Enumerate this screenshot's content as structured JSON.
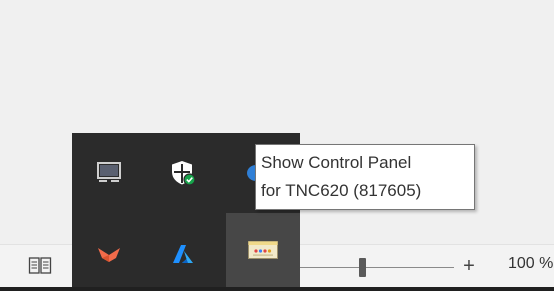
{
  "tooltip": {
    "line1": "Show Control Panel",
    "line2": "for TNC620 (817605)"
  },
  "status_bar": {
    "zoom_plus": "+",
    "zoom_level": "100 %"
  },
  "tray_icons": [
    {
      "name": "monitor-icon"
    },
    {
      "name": "windows-security-shield-icon"
    },
    {
      "name": "cloud-app-icon"
    },
    {
      "name": "orange-bird-app-icon"
    },
    {
      "name": "azure-a-icon"
    },
    {
      "name": "control-panel-icon"
    }
  ],
  "colors": {
    "flyout_bg": "#2b2b2b",
    "hover_bg": "#474747",
    "shield_check": "#16a34a",
    "orange_app": "#f26b4a",
    "azure_blue": "#1e90ff"
  }
}
